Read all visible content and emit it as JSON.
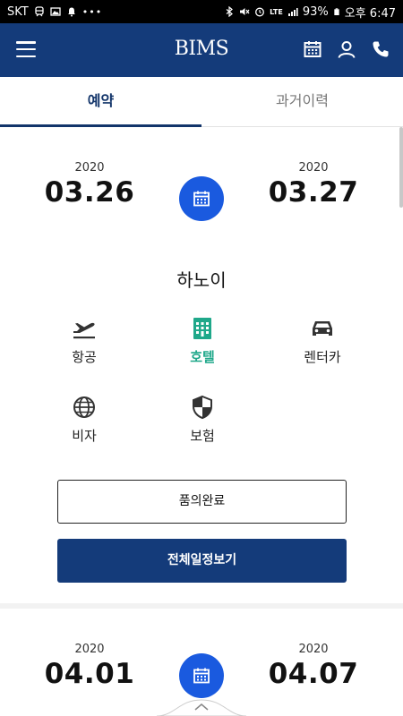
{
  "status_bar": {
    "carrier": "SKT",
    "dots": "•••",
    "network": "LTE",
    "battery": "93%",
    "time": "오후 6:47"
  },
  "header": {
    "logo": "BIMS",
    "icons": [
      "menu-icon",
      "calendar-icon",
      "user-icon",
      "phone-icon"
    ]
  },
  "tabs": [
    {
      "label": "예약",
      "active": true
    },
    {
      "label": "과거이력",
      "active": false
    }
  ],
  "trip1": {
    "start_year": "2020",
    "start_date": "03.26",
    "end_year": "2020",
    "end_date": "03.27",
    "city": "하노이",
    "services": [
      {
        "label": "항공",
        "icon": "airplane-icon",
        "selected": false
      },
      {
        "label": "호텔",
        "icon": "hotel-icon",
        "selected": true
      },
      {
        "label": "렌터카",
        "icon": "car-icon",
        "selected": false
      },
      {
        "label": "비자",
        "icon": "globe-icon",
        "selected": false
      },
      {
        "label": "보험",
        "icon": "shield-icon",
        "selected": false
      }
    ],
    "approve_button": "품의완료",
    "schedule_button": "전체일정보기"
  },
  "trip2": {
    "start_year": "2020",
    "start_date": "04.01",
    "end_year": "2020",
    "end_date": "04.07"
  },
  "colors": {
    "brand": "#143b7a",
    "accent": "#1a5adf",
    "selected": "#1fa88a"
  }
}
